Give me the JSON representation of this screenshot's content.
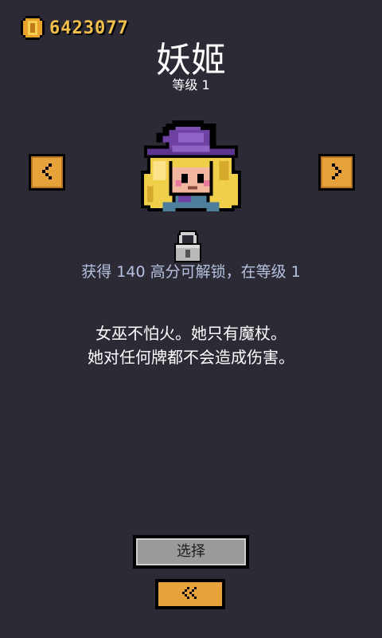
{
  "currency": {
    "coins": "6423077",
    "coin_color": "#f2c04b",
    "icon": "gold-coin-icon"
  },
  "character": {
    "name": "妖姬",
    "level_text": "等级 1",
    "locked": true,
    "unlock_text": "获得 140 高分可解锁，在等级 1",
    "description": [
      "女巫不怕火。她只有魔杖。",
      "她对任何牌都不会造成伤害。"
    ]
  },
  "nav": {
    "prev_icon": "chevron-left-icon",
    "next_icon": "chevron-right-icon",
    "back_icon": "double-chevron-left-icon"
  },
  "buttons": {
    "select_label": "选择"
  },
  "colors": {
    "background": "#2b2a35",
    "accent": "#e8a23c",
    "unlock_text": "#b6c2e0"
  }
}
